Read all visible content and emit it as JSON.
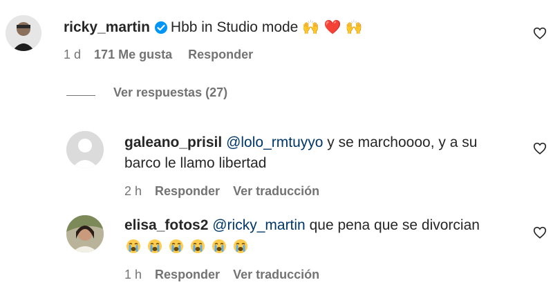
{
  "comments": [
    {
      "username": "ricky_martin",
      "verified": true,
      "text": "Hbb in Studio mode",
      "emojis": "🙌 ❤️ 🙌",
      "time": "1 d",
      "likes": "171 Me gusta",
      "reply": "Responder"
    }
  ],
  "view_replies": "Ver respuestas (27)",
  "replies": [
    {
      "username": "galeano_prisil",
      "mention": "@lolo_rmtuyyo",
      "text_line1": "y se marchoooo, y a su",
      "text_line2": "barco le llamo libertad",
      "time": "2 h",
      "reply": "Responder",
      "translate": "Ver traducción"
    },
    {
      "username": "elisa_fotos2",
      "mention": "@ricky_martin",
      "text": "que pena que se divorcian",
      "emoji_name": "crying-face",
      "emoji_count": 6,
      "time": "1 h",
      "reply": "Responder",
      "translate": "Ver traducción"
    }
  ],
  "icons": {
    "like": "heart-outline-icon",
    "verified": "verified-badge-icon"
  },
  "colors": {
    "text": "#262626",
    "muted": "#737373",
    "mention": "#00376b",
    "verified": "#0095f6"
  }
}
